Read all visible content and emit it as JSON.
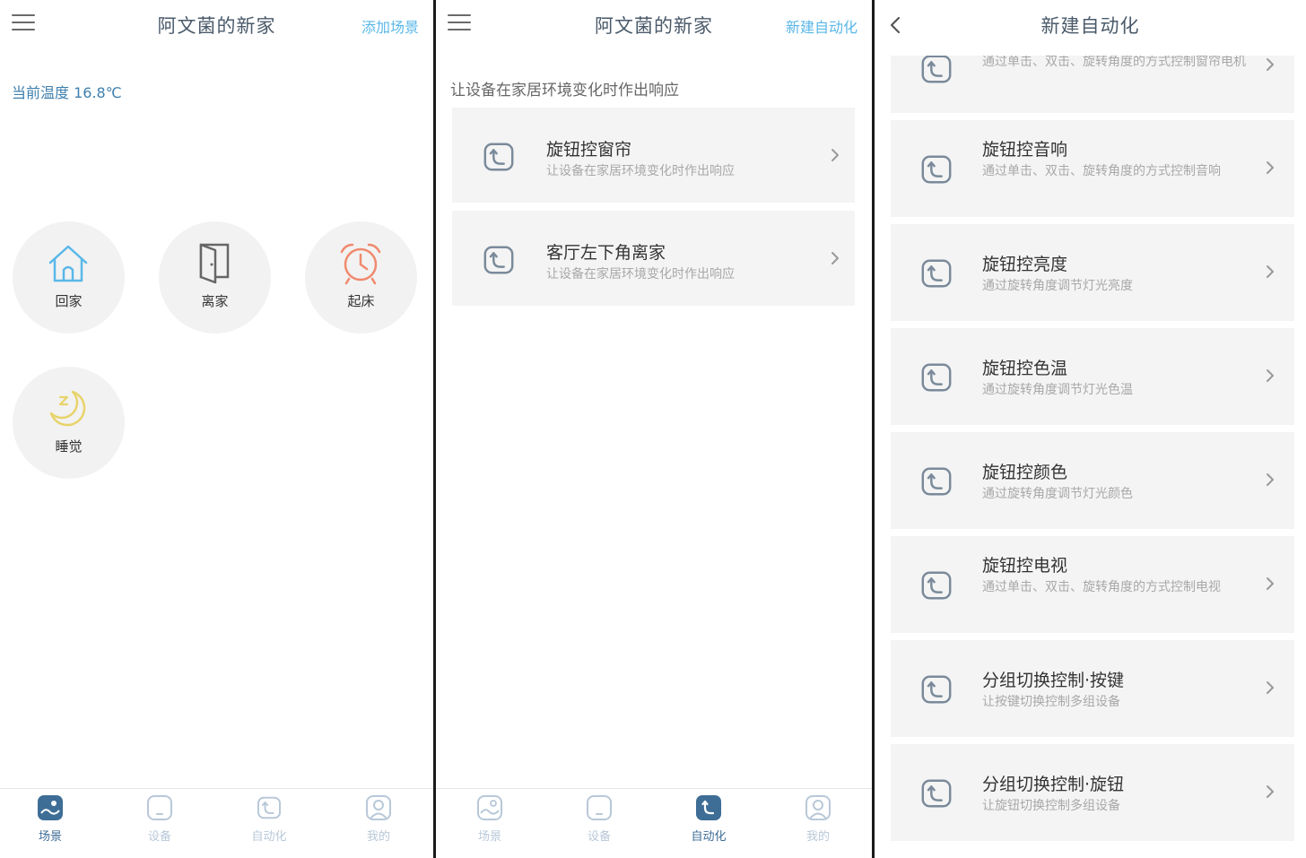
{
  "panel1": {
    "title": "阿文菌的新家",
    "action": "添加场景",
    "temperature": "当前温度 16.8℃",
    "scenes": [
      {
        "label": "回家",
        "icon": "home-icon"
      },
      {
        "label": "离家",
        "icon": "door-icon"
      },
      {
        "label": "起床",
        "icon": "alarm-clock-icon"
      },
      {
        "label": "睡觉",
        "icon": "moon-sleep-icon"
      }
    ],
    "tabs": [
      {
        "label": "场景",
        "active": true
      },
      {
        "label": "设备",
        "active": false
      },
      {
        "label": "自动化",
        "active": false
      },
      {
        "label": "我的",
        "active": false
      }
    ]
  },
  "panel2": {
    "title": "阿文菌的新家",
    "action": "新建自动化",
    "subtitle": "让设备在家居环境变化时作出响应",
    "items": [
      {
        "title": "旋钮控窗帘",
        "desc": "让设备在家居环境变化时作出响应"
      },
      {
        "title": "客厅左下角离家",
        "desc": "让设备在家居环境变化时作出响应"
      }
    ],
    "tabs": [
      {
        "label": "场景",
        "active": false
      },
      {
        "label": "设备",
        "active": false
      },
      {
        "label": "自动化",
        "active": true
      },
      {
        "label": "我的",
        "active": false
      }
    ]
  },
  "panel3": {
    "title": "新建自动化",
    "items": [
      {
        "title": "",
        "desc": "通过单击、双击、旋转角度的方式控制窗帘电机"
      },
      {
        "title": "旋钮控音响",
        "desc": "通过单击、双击、旋转角度的方式控制音响"
      },
      {
        "title": "旋钮控亮度",
        "desc": "通过旋转角度调节灯光亮度"
      },
      {
        "title": "旋钮控色温",
        "desc": "通过旋转角度调节灯光色温"
      },
      {
        "title": "旋钮控颜色",
        "desc": "通过旋转角度调节灯光颜色"
      },
      {
        "title": "旋钮控电视",
        "desc": "通过单击、双击、旋转角度的方式控制电视"
      },
      {
        "title": "分组切换控制·按键",
        "desc": "让按键切换控制多组设备"
      },
      {
        "title": "分组切换控制·旋钮",
        "desc": "让旋钮切换控制多组设备"
      }
    ]
  },
  "colors": {
    "accent": "#5ab7e8",
    "tab_active": "#3e6d96",
    "tab_inactive": "#b8c8d8",
    "temp_text": "#3f7fae",
    "card_bg": "#f4f4f4",
    "scene_bg": "#f2f2f2"
  }
}
